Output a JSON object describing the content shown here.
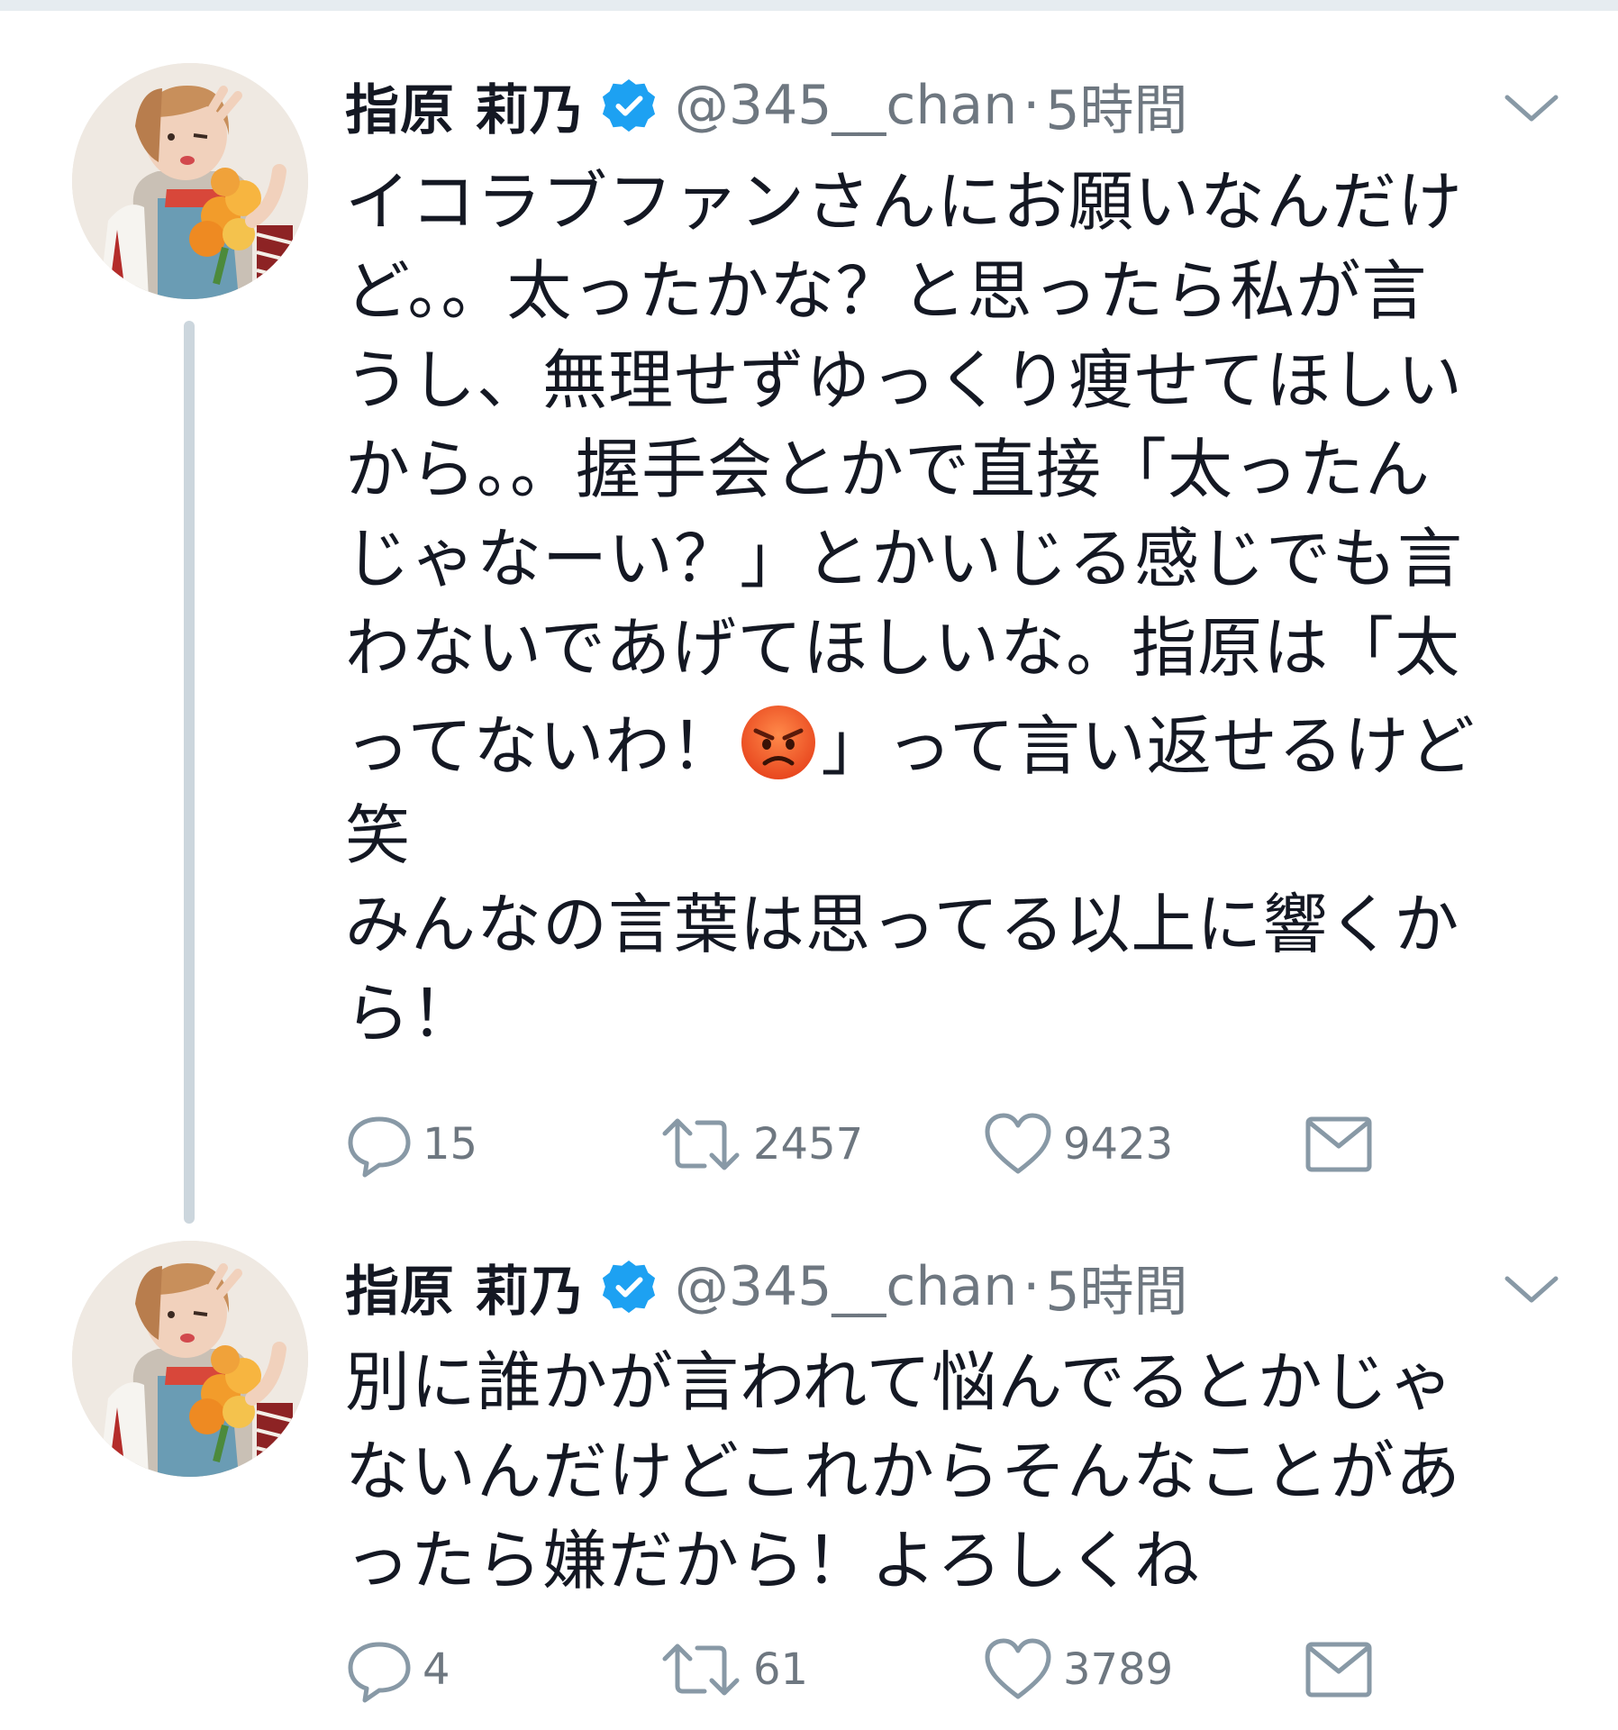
{
  "tweets": [
    {
      "author": {
        "name": "指原 莉乃",
        "handle": "@345__chan",
        "time": "5時間",
        "separator": "·",
        "verified": true
      },
      "text_lines": [
        "イコラブファンさんにお願いなんだけ",
        "ど。。太ったかな？と思ったら私が言",
        "うし、無理せずゆっくり痩せてほしい",
        "から。。握手会とかで直接「太ったん",
        "じゃなーい？」とかいじる感じでも言",
        "わないであげてほしいな。指原は「太"
      ],
      "line7_before": "ってないわ！",
      "line7_emoji": "angry-face-emoji",
      "line7_after": "」って言い返せるけど",
      "text_lines_after": [
        "笑",
        "みんなの言葉は思ってる以上に響くか",
        "ら！"
      ],
      "stats": {
        "replies": "15",
        "retweets": "2457",
        "likes": "9423"
      },
      "icons": [
        "reply-icon",
        "retweet-icon",
        "like-icon",
        "direct-message-icon",
        "chevron-down-icon",
        "verified-badge-icon"
      ]
    },
    {
      "author": {
        "name": "指原 莉乃",
        "handle": "@345__chan",
        "time": "5時間",
        "separator": "·",
        "verified": true
      },
      "text_lines": [
        "別に誰かが言われて悩んでるとかじゃ",
        "ないんだけどこれからそんなことがあ",
        "ったら嫌だから！よろしくね"
      ],
      "stats": {
        "replies": "4",
        "retweets": "61",
        "likes": "3789"
      },
      "icons": [
        "reply-icon",
        "retweet-icon",
        "like-icon",
        "direct-message-icon",
        "chevron-down-icon",
        "verified-badge-icon"
      ]
    }
  ],
  "colors": {
    "text": "#141823",
    "secondary": "#6e7780",
    "verified": "#1da1f2",
    "thread_line": "#ccd6dd",
    "divider": "#e6ecf0"
  }
}
